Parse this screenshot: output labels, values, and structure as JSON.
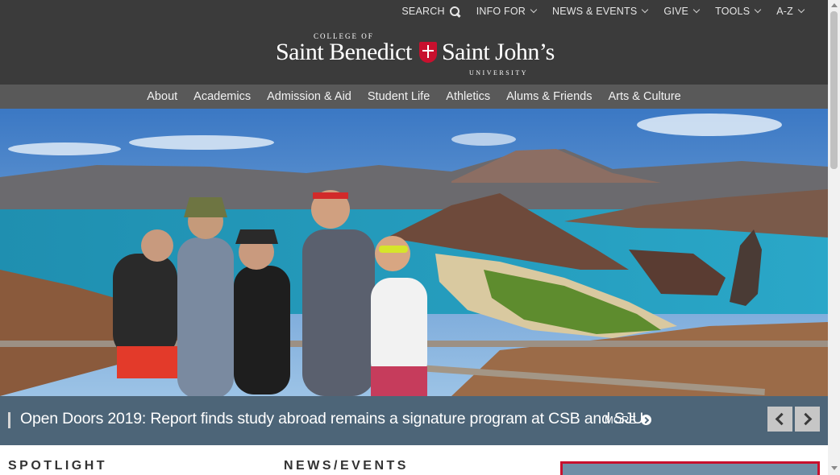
{
  "utility_nav": [
    {
      "label": "SEARCH",
      "icon": "search-icon"
    },
    {
      "label": "INFO FOR",
      "icon": "chevron-down-icon"
    },
    {
      "label": "NEWS & EVENTS",
      "icon": "chevron-down-icon"
    },
    {
      "label": "GIVE",
      "icon": "chevron-down-icon"
    },
    {
      "label": "TOOLS",
      "icon": "chevron-down-icon"
    },
    {
      "label": "A-Z",
      "icon": "chevron-down-icon"
    }
  ],
  "logo": {
    "college_of": "COLLEGE OF",
    "saint_benedict": "Saint Benedict",
    "saint_johns": "Saint John’s",
    "university": "UNIVERSITY"
  },
  "main_nav": [
    "About",
    "Academics",
    "Admission & Aid",
    "Student Life",
    "Athletics",
    "Alums & Friends",
    "Arts & Culture"
  ],
  "hero": {
    "headline": "Open Doors 2019: Report finds study abroad remains a signature program at CSB and SJU",
    "more_label": "MORE"
  },
  "sections": {
    "spotlight": "SPOTLIGHT",
    "news_events": "NEWS/EVENTS"
  },
  "colors": {
    "header_bg": "#3b3b3b",
    "nav_bg": "#595959",
    "caption_bg": "#4d6578",
    "brand_red": "#c8102e"
  }
}
